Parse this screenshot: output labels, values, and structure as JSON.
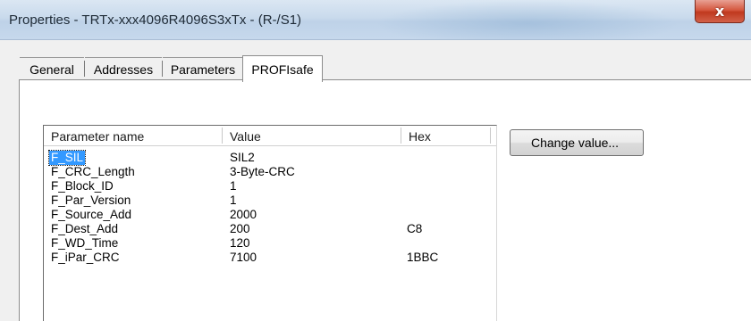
{
  "window": {
    "title": "Properties - TRTx-xxx4096R4096S3xTx - (R-/S1)",
    "close_glyph": "x",
    "accent_colors": {
      "close_button": "#c7432a",
      "selection": "#3399ff",
      "titlebar": "#c9daec"
    }
  },
  "tabs": [
    {
      "label": "General"
    },
    {
      "label": "Addresses"
    },
    {
      "label": "Parameters"
    },
    {
      "label": "PROFIsafe",
      "active": true
    }
  ],
  "parameters_table": {
    "columns": {
      "name": "Parameter name",
      "value": "Value",
      "hex": "Hex"
    },
    "rows": [
      {
        "name": "F_SIL",
        "value": "SIL2",
        "hex": "",
        "selected": true
      },
      {
        "name": "F_CRC_Length",
        "value": "3-Byte-CRC",
        "hex": ""
      },
      {
        "name": "F_Block_ID",
        "value": "1",
        "hex": ""
      },
      {
        "name": "F_Par_Version",
        "value": "1",
        "hex": ""
      },
      {
        "name": "F_Source_Add",
        "value": "2000",
        "hex": ""
      },
      {
        "name": "F_Dest_Add",
        "value": "200",
        "hex": "C8"
      },
      {
        "name": "F_WD_Time",
        "value": "120",
        "hex": ""
      },
      {
        "name": "F_iPar_CRC",
        "value": "7100",
        "hex": "1BBC"
      }
    ]
  },
  "buttons": {
    "change_value": "Change value..."
  }
}
